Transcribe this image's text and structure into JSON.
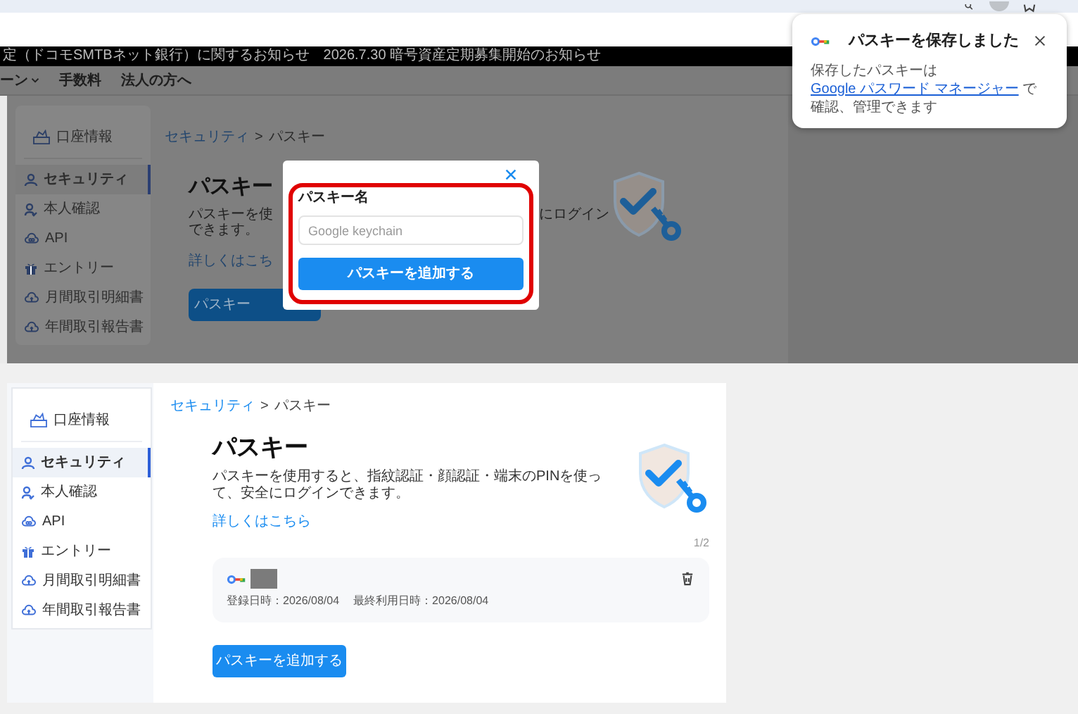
{
  "browser": {
    "popup": {
      "title": "パスキーを保存しました",
      "body_before": "保存したパスキーは",
      "link": "Google パスワード マネージャー",
      "body_after": "で確認、管理できます"
    }
  },
  "background_page": {
    "ticker": [
      "定（ドコモSMTBネット銀行）に関するお知らせ",
      "2026.7.30 暗号資産定期募集開始のお知らせ"
    ],
    "nav": [
      {
        "label": "ーン",
        "has_menu": true
      },
      {
        "label": "手数料",
        "has_menu": false
      },
      {
        "label": "法人の方へ",
        "has_menu": false
      }
    ],
    "sidebar": [
      {
        "kind": "header",
        "label": "口座情報",
        "selected": false
      },
      {
        "kind": "link",
        "label": "セキュリティ",
        "selected": true
      },
      {
        "kind": "link",
        "label": "本人確認",
        "selected": false
      },
      {
        "kind": "link",
        "label": "API",
        "selected": false
      },
      {
        "kind": "link",
        "label": "エントリー",
        "selected": false
      },
      {
        "kind": "link",
        "label": "月間取引明細書",
        "selected": false
      },
      {
        "kind": "link",
        "label": "年間取引報告書",
        "selected": false
      }
    ],
    "breadcrumb": [
      "セキュリティ",
      "パスキー"
    ],
    "breadcrumb_separator": ">",
    "title": "パスキー",
    "description_left": "パスキーを使",
    "description_right": "にログイン",
    "description_line2": "できます。",
    "link": "詳しくはこち",
    "button": "パスキー"
  },
  "dialog": {
    "label": "パスキー名",
    "placeholder": "Google keychain",
    "button": "パスキーを追加する",
    "highlighted": true
  },
  "page": {
    "sidebar": [
      {
        "kind": "header",
        "label": "口座情報",
        "selected": false
      },
      {
        "kind": "link",
        "label": "セキュリティ",
        "selected": true
      },
      {
        "kind": "link",
        "label": "本人確認",
        "selected": false
      },
      {
        "kind": "link",
        "label": "API",
        "selected": false
      },
      {
        "kind": "link",
        "label": "エントリー",
        "selected": false
      },
      {
        "kind": "link",
        "label": "月間取引明細書",
        "selected": false
      },
      {
        "kind": "link",
        "label": "年間取引報告書",
        "selected": false
      }
    ],
    "breadcrumb": [
      "セキュリティ",
      "パスキー"
    ],
    "breadcrumb_separator": ">",
    "title": "パスキー",
    "description": "パスキーを使用すると、指紋認証・顔認証・端末のPINを使って、安全にログインできます。",
    "link": "詳しくはこちら",
    "pager": "1/2",
    "passkeys": [
      {
        "registered": "登録日時：2026/08/04",
        "last_used": "最終利用日時：2026/08/04"
      }
    ],
    "button": "パスキーを追加する"
  }
}
